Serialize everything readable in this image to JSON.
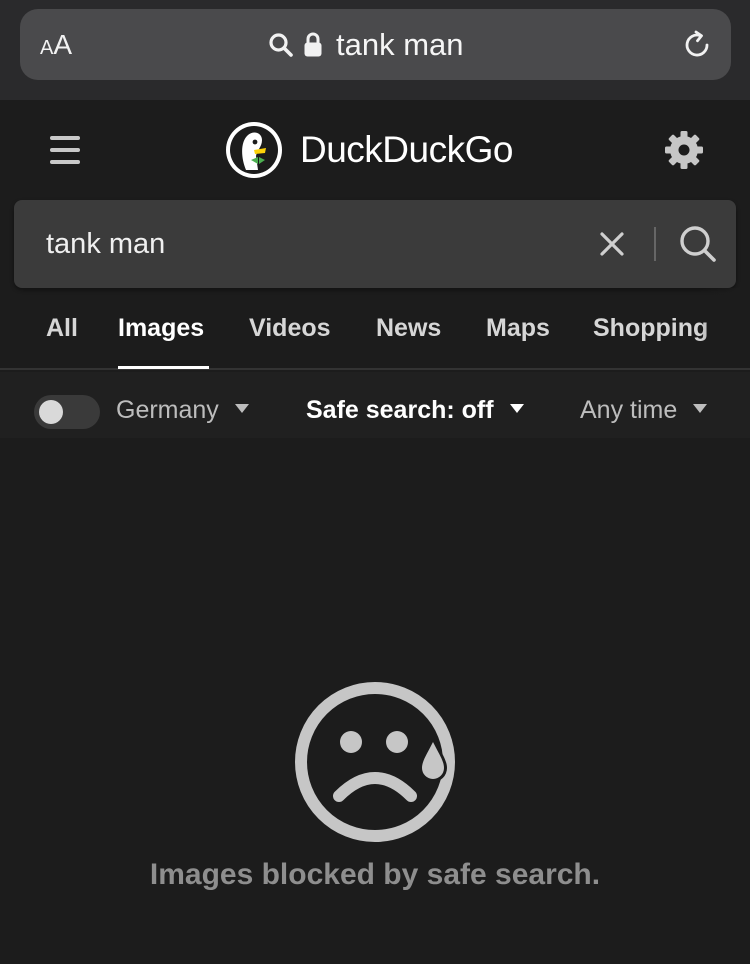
{
  "browser": {
    "text_size_small": "A",
    "text_size_large": "A",
    "url": "tank man"
  },
  "header": {
    "brand": "DuckDuckGo"
  },
  "search": {
    "query": "tank man"
  },
  "tabs": [
    {
      "label": "All",
      "active": false
    },
    {
      "label": "Images",
      "active": true
    },
    {
      "label": "Videos",
      "active": false
    },
    {
      "label": "News",
      "active": false
    },
    {
      "label": "Maps",
      "active": false
    },
    {
      "label": "Shopping",
      "active": false
    }
  ],
  "filters": {
    "region": "Germany",
    "safe_search": "Safe search: off",
    "time": "Any time",
    "region_toggle_on": false
  },
  "empty_state": {
    "message": "Images blocked by safe search."
  },
  "colors": {
    "background": "#1c1c1c",
    "search_box": "#3b3b3b",
    "icon_gray": "#c6c6c6",
    "ddg_orange": "#de5833"
  }
}
